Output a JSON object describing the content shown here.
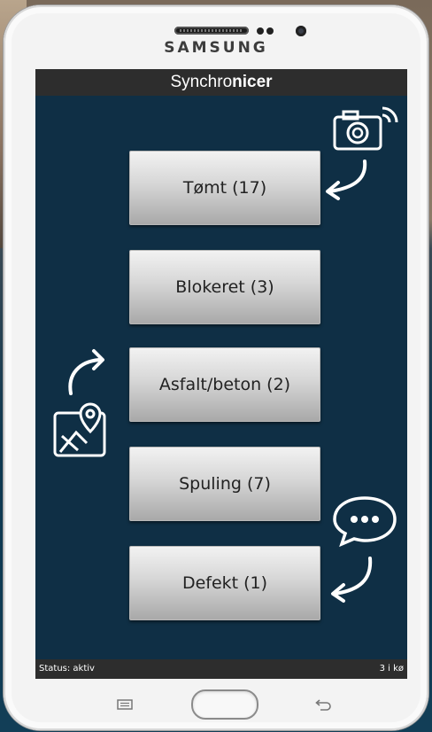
{
  "device": {
    "brand": "SAMSUNG"
  },
  "app": {
    "title_prefix": "Synchro",
    "title_bold": "nicer"
  },
  "buttons": [
    {
      "label": "Tømt (17)"
    },
    {
      "label": "Blokeret (3)"
    },
    {
      "label": "Asfalt/beton (2)"
    },
    {
      "label": "Spuling (7)"
    },
    {
      "label": "Defekt (1)"
    }
  ],
  "status": {
    "left": "Status: aktiv",
    "right": "3 i kø"
  },
  "icons": {
    "camera": "camera-icon",
    "map": "map-pin-icon",
    "chat": "chat-bubble-icon",
    "arrow": "curved-arrow-icon"
  },
  "colors": {
    "screen_bg": "#0f2f45",
    "bar_bg": "#2d2d2d",
    "frame": "#f3f3f3"
  }
}
